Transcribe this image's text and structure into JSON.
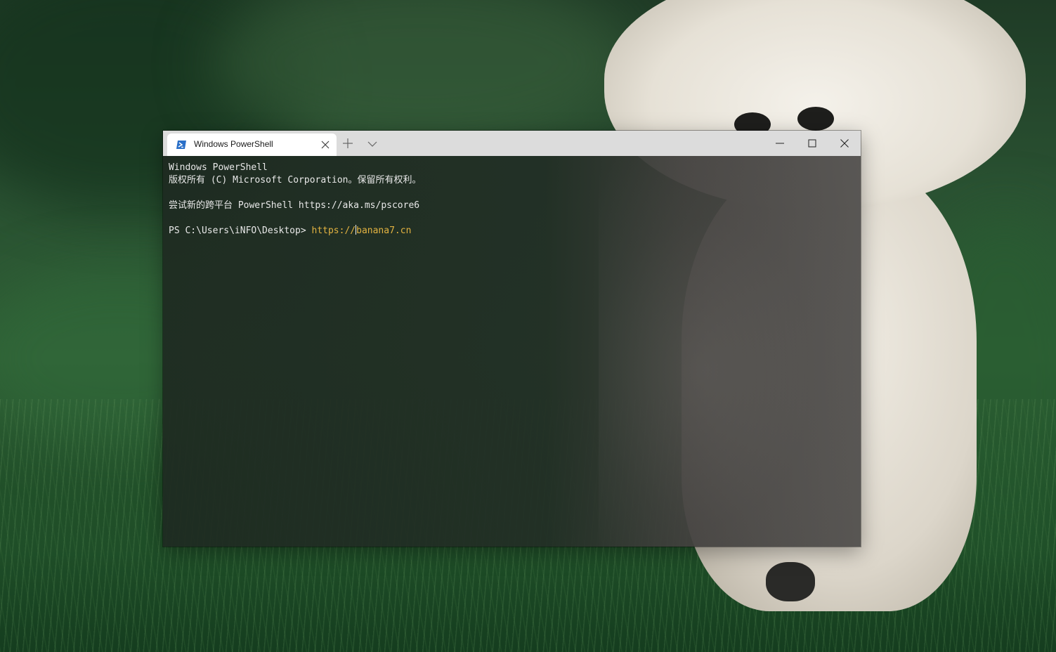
{
  "window": {
    "tab_title": "Windows PowerShell",
    "tab_icon": "powershell-icon",
    "new_tab_icon": "plus-icon",
    "dropdown_icon": "chevron-down-icon",
    "controls": {
      "minimize_icon": "minimize-icon",
      "maximize_icon": "maximize-icon",
      "close_icon": "close-icon"
    }
  },
  "console": {
    "lines": [
      "Windows PowerShell",
      "版权所有 (C) Microsoft Corporation。保留所有权利。",
      "",
      "尝试新的跨平台 PowerShell https://aka.ms/pscore6",
      ""
    ],
    "prompt": "PS C:\\Users\\iNFO\\Desktop> ",
    "input_before_cursor": "https://",
    "input_after_cursor": "banana7.cn"
  },
  "colors": {
    "console_text": "#e8e8e8",
    "command_input": "#e3b341",
    "titlebar": "#dcdcdc",
    "tab_active": "#ffffff",
    "powershell_blue": "#2a6fc8"
  }
}
